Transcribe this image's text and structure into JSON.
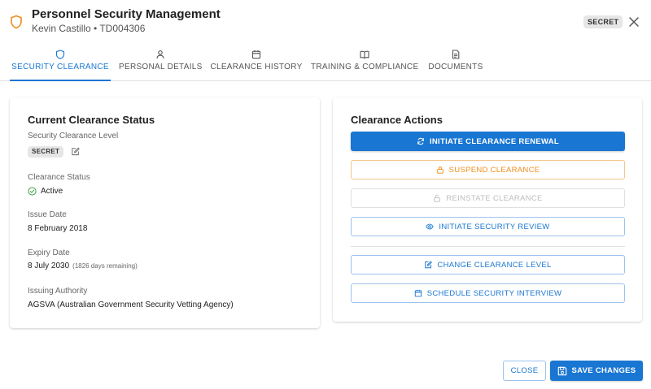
{
  "header": {
    "title": "Personnel Security Management",
    "subtitle": "Kevin Castillo • TD004306",
    "badge": "SECRET",
    "icon": "shield-icon",
    "accent": "#f08c1a"
  },
  "tabs": [
    {
      "label": "SECURITY CLEARANCE",
      "icon": "shield-icon",
      "active": true
    },
    {
      "label": "PERSONAL DETAILS",
      "icon": "person-icon",
      "active": false
    },
    {
      "label": "CLEARANCE HISTORY",
      "icon": "calendar-icon",
      "active": false
    },
    {
      "label": "TRAINING & COMPLIANCE",
      "icon": "book-icon",
      "active": false
    },
    {
      "label": "DOCUMENTS",
      "icon": "document-icon",
      "active": false
    }
  ],
  "status_card": {
    "title": "Current Clearance Status",
    "level_label": "Security Clearance Level",
    "level_value": "SECRET",
    "status_label": "Clearance Status",
    "status_value": "Active",
    "issue_label": "Issue Date",
    "issue_value": "8 February 2018",
    "expiry_label": "Expiry Date",
    "expiry_value": "8 July 2030",
    "expiry_note": "(1826 days remaining)",
    "authority_label": "Issuing Authority",
    "authority_value": "AGSVA (Australian Government Security Vetting Agency)",
    "status_color": "#43a047"
  },
  "actions_card": {
    "title": "Clearance Actions",
    "renew": "INITIATE CLEARANCE RENEWAL",
    "suspend": "SUSPEND CLEARANCE",
    "reinstate": "REINSTATE CLEARANCE",
    "review": "INITIATE SECURITY REVIEW",
    "change_level": "CHANGE CLEARANCE LEVEL",
    "interview": "SCHEDULE SECURITY INTERVIEW"
  },
  "footer": {
    "close": "CLOSE",
    "save": "SAVE CHANGES"
  },
  "colors": {
    "primary": "#1976d2",
    "warning": "#f08c1a",
    "disabled": "#bdbdbd"
  }
}
